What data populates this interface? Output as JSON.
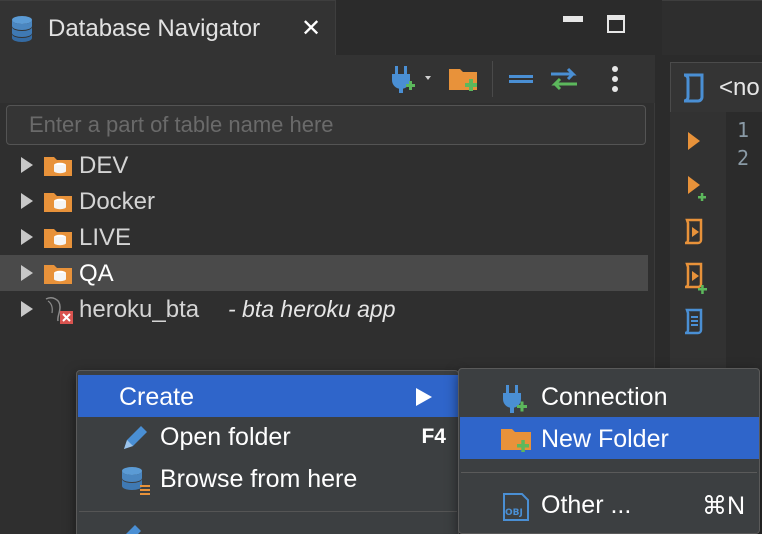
{
  "panel": {
    "title": "Database Navigator",
    "close_glyph": "✕"
  },
  "filter": {
    "placeholder": "Enter a part of table name here"
  },
  "tree": {
    "items": [
      {
        "label": "DEV",
        "icon": "database-folder-icon"
      },
      {
        "label": "Docker",
        "icon": "database-folder-icon"
      },
      {
        "label": "LIVE",
        "icon": "database-folder-icon"
      },
      {
        "label": "QA",
        "icon": "database-folder-icon",
        "selected": true
      },
      {
        "label": "heroku_bta",
        "description": "- bta heroku app",
        "icon": "postgres-connection-icon"
      }
    ]
  },
  "editor": {
    "tab_label": "<no",
    "line_numbers": [
      "1",
      "2"
    ]
  },
  "context_menu": {
    "items": [
      {
        "label": "Create",
        "highlighted": true,
        "has_submenu": true
      },
      {
        "label": "Open folder",
        "accelerator": "F4",
        "icon": "pencil-icon"
      },
      {
        "label": "Browse from here",
        "icon": "database-browse-icon"
      }
    ]
  },
  "submenu": {
    "items": [
      {
        "label": "Connection",
        "icon": "plug-add-icon"
      },
      {
        "label": "New Folder",
        "icon": "folder-add-icon",
        "highlighted": true
      },
      {
        "label": "Other ...",
        "accelerator": "⌘N",
        "icon": "obj-icon"
      }
    ]
  },
  "colors": {
    "accent": "#2f65ca",
    "folder": "#e8923a",
    "plug": "#4a8fd4",
    "add": "#5cb85c"
  }
}
